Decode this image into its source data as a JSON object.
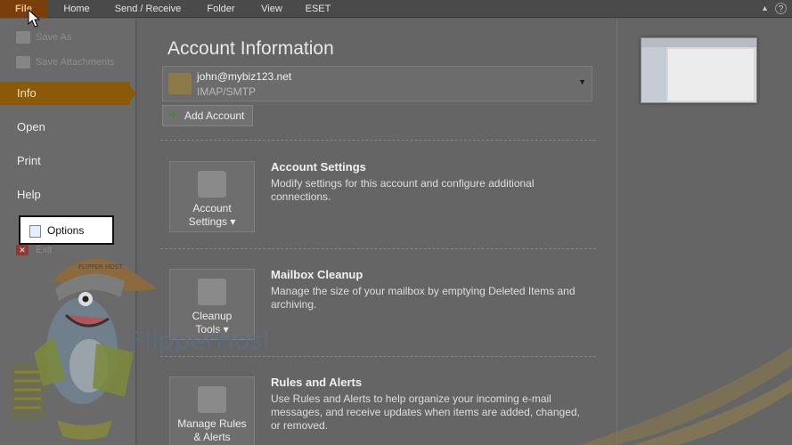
{
  "ribbon": {
    "tabs": [
      "File",
      "Home",
      "Send / Receive",
      "Folder",
      "View",
      "ESET"
    ]
  },
  "sidebar": {
    "small_items": [
      "Save As",
      "Save Attachments"
    ],
    "items": [
      "Info",
      "Open",
      "Print",
      "Help"
    ],
    "active": "Info",
    "options_label": "Options",
    "exit_label": "Exit"
  },
  "main": {
    "title": "Account Information",
    "account": {
      "email": "john@mybiz123.net",
      "type": "IMAP/SMTP"
    },
    "add_account_label": "Add Account",
    "sections": [
      {
        "button_line1": "Account",
        "button_line2": "Settings ▾",
        "title": "Account Settings",
        "description": "Modify settings for this account and configure additional connections."
      },
      {
        "button_line1": "Cleanup",
        "button_line2": "Tools ▾",
        "title": "Mailbox Cleanup",
        "description": "Manage the size of your mailbox by emptying Deleted Items and archiving."
      },
      {
        "button_line1": "Manage Rules",
        "button_line2": "& Alerts",
        "title": "Rules and Alerts",
        "description": "Use Rules and Alerts to help organize your incoming e-mail messages, and receive updates when items are added, changed, or removed."
      }
    ]
  },
  "watermark": {
    "brand": "FlipperHost",
    "cap_text": "FLIPPER HOST"
  },
  "colors": {
    "file_tab": "#7a3d0c",
    "active_nav": "#8a5a08",
    "overlay_gray": "#656565"
  }
}
